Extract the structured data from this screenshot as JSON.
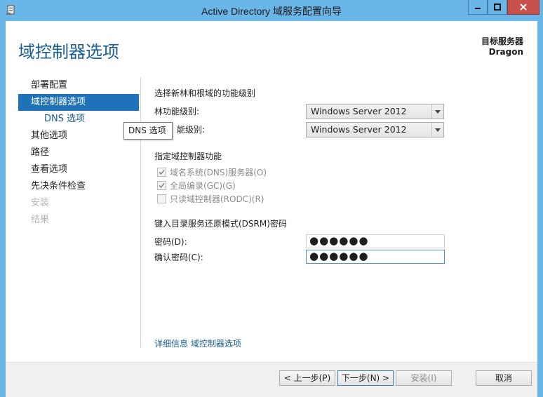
{
  "window": {
    "title": "Active Directory 域服务配置向导",
    "controls": {
      "minimize": "minimize-icon",
      "maximize": "maximize-icon",
      "close": "close-icon"
    }
  },
  "header": {
    "page_title": "域控制器选项",
    "target_server_label": "目标服务器",
    "target_server_name": "Dragon"
  },
  "nav": {
    "items": [
      {
        "label": "部署配置",
        "state": "normal"
      },
      {
        "label": "域控制器选项",
        "state": "selected"
      },
      {
        "label": "DNS 选项",
        "state": "sub"
      },
      {
        "label": "其他选项",
        "state": "normal"
      },
      {
        "label": "路径",
        "state": "normal"
      },
      {
        "label": "查看选项",
        "state": "normal"
      },
      {
        "label": "先决条件检查",
        "state": "normal"
      },
      {
        "label": "安装",
        "state": "disabled"
      },
      {
        "label": "结果",
        "state": "disabled"
      }
    ]
  },
  "tooltip": "DNS 选项",
  "functional_levels": {
    "heading": "选择新林和根域的功能级别",
    "forest_label": "林功能级别:",
    "forest_value": "Windows Server 2012",
    "domain_label": "能级别:",
    "domain_value": "Windows Server 2012"
  },
  "dc_capabilities": {
    "heading": "指定域控制器功能",
    "options": [
      {
        "label": "域名系统(DNS)服务器(O)",
        "checked": true
      },
      {
        "label": "全局编录(GC)(G)",
        "checked": true
      },
      {
        "label": "只读域控制器(RODC)(R)",
        "checked": false
      }
    ]
  },
  "dsrm": {
    "heading": "键入目录服务还原模式(DSRM)密码",
    "password_label": "密码(D):",
    "password_value": "●●●●●●",
    "confirm_label": "确认密码(C):",
    "confirm_value": "●●●●●●"
  },
  "more_info_link": "详细信息 域控制器选项",
  "footer": {
    "prev": "< 上一步(P)",
    "next": "下一步(N) >",
    "install": "安装(I)",
    "cancel": "取消"
  }
}
